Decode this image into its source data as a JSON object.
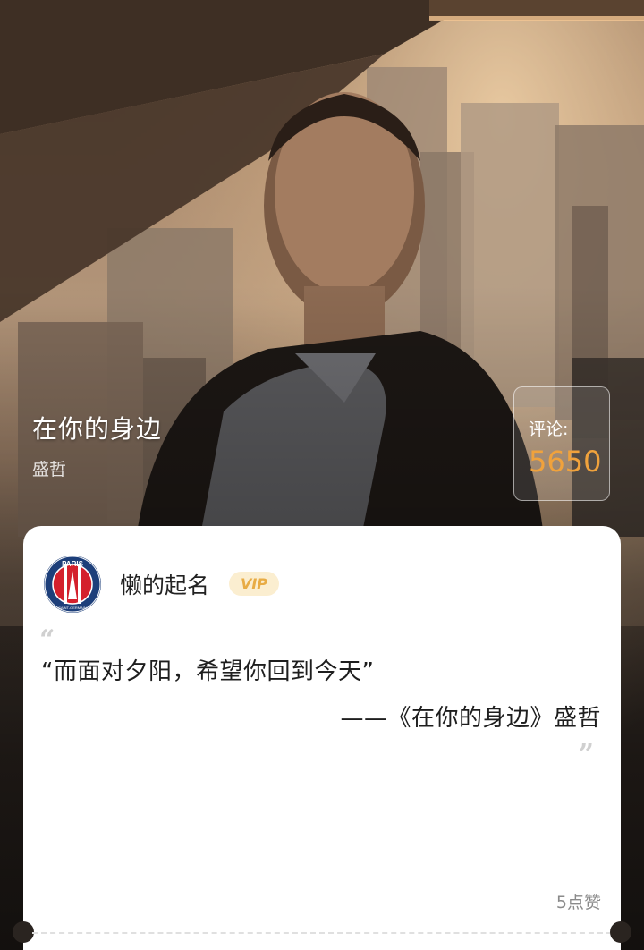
{
  "song": {
    "title": "在你的身边",
    "artist": "盛哲"
  },
  "comments": {
    "label": "评论:",
    "count": "5650",
    "count_color": "#f0a23c"
  },
  "card": {
    "user": {
      "name": "懒的起名",
      "badge": "VIP",
      "avatar_icon": "psg-logo-icon",
      "avatar_text_top": "PARIS",
      "avatar_text_bottom": "SAINT-GERMAIN"
    },
    "quote_open": "“",
    "lyric": "“而面对夕阳，希望你回到今天”",
    "source": "——《在你的身边》盛哲",
    "quote_close": "”",
    "likes": "5点赞"
  },
  "colors": {
    "accent": "#f0a23c",
    "vip_bg": "#fbeed0",
    "vip_text": "#e8ac45",
    "psg_blue": "#1d3f7a",
    "psg_red": "#d4202c"
  }
}
